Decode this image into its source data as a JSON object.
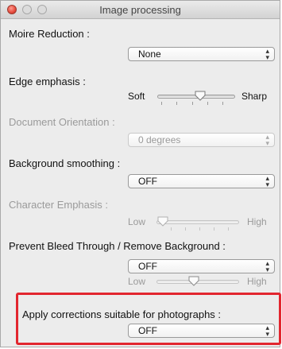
{
  "window": {
    "title": "Image processing"
  },
  "moire": {
    "label": "Moire Reduction :",
    "value": "None"
  },
  "edge": {
    "label": "Edge emphasis :",
    "low": "Soft",
    "high": "Sharp",
    "level": 0.55
  },
  "orientation": {
    "label": "Document Orientation :",
    "value": "0 degrees"
  },
  "bg_smoothing": {
    "label": "Background smoothing :",
    "value": "OFF"
  },
  "char_emphasis": {
    "label": "Character Emphasis :",
    "low": "Low",
    "high": "High",
    "level": 0.0
  },
  "bleed": {
    "label": "Prevent Bleed Through / Remove Background :",
    "value": "OFF",
    "low": "Low",
    "high": "High",
    "level": 0.45
  },
  "photo": {
    "label": "Apply corrections suitable for photographs :",
    "value": "OFF"
  },
  "colors": {
    "highlight": "#e2262f",
    "close_button": "#e5493b"
  },
  "icons": [
    "close-icon",
    "minimize-icon",
    "zoom-icon",
    "popup-arrows-icon",
    "slider-knob-icon"
  ]
}
